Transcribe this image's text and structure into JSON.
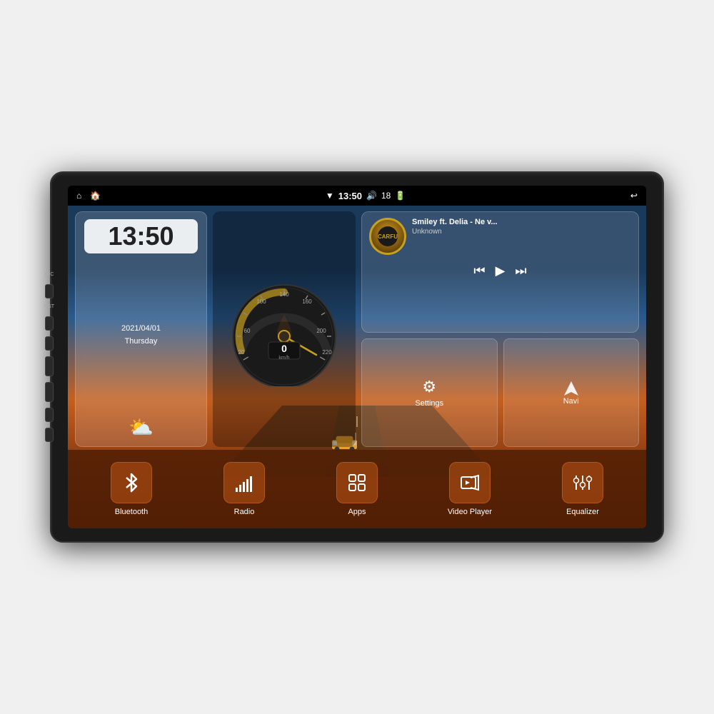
{
  "device": {
    "label": "Car Android Head Unit"
  },
  "status_bar": {
    "home_icon": "⌂",
    "house_icon": "🏠",
    "wifi_icon": "▼",
    "time": "13:50",
    "volume_icon": "🔊",
    "volume_level": "18",
    "battery_icon": "🔋",
    "back_icon": "↩"
  },
  "clock": {
    "time": "13:50",
    "date": "2021/04/01",
    "day": "Thursday",
    "weather_icon": "⛅"
  },
  "music": {
    "title": "Smiley ft. Delia - Ne v...",
    "artist": "Unknown",
    "album_logo": "CARFU",
    "prev_icon": "⏮",
    "play_icon": "▶",
    "next_icon": "⏭"
  },
  "tiles": {
    "settings_label": "Settings",
    "settings_icon": "⚙",
    "navi_label": "Navi",
    "navi_icon": "▲"
  },
  "bottom_buttons": [
    {
      "id": "bluetooth",
      "label": "Bluetooth",
      "icon": "bluetooth"
    },
    {
      "id": "radio",
      "label": "Radio",
      "icon": "radio"
    },
    {
      "id": "apps",
      "label": "Apps",
      "icon": "apps"
    },
    {
      "id": "video-player",
      "label": "Video Player",
      "icon": "video"
    },
    {
      "id": "equalizer",
      "label": "Equalizer",
      "icon": "equalizer"
    }
  ],
  "side_buttons": [
    {
      "label": "MIC",
      "type": "small"
    },
    {
      "label": "RST",
      "type": "small"
    },
    {
      "label": "",
      "type": "power"
    },
    {
      "label": "",
      "type": "home"
    },
    {
      "label": "",
      "type": "back"
    },
    {
      "label": "",
      "type": "vol_up"
    },
    {
      "label": "",
      "type": "vol_down"
    }
  ]
}
